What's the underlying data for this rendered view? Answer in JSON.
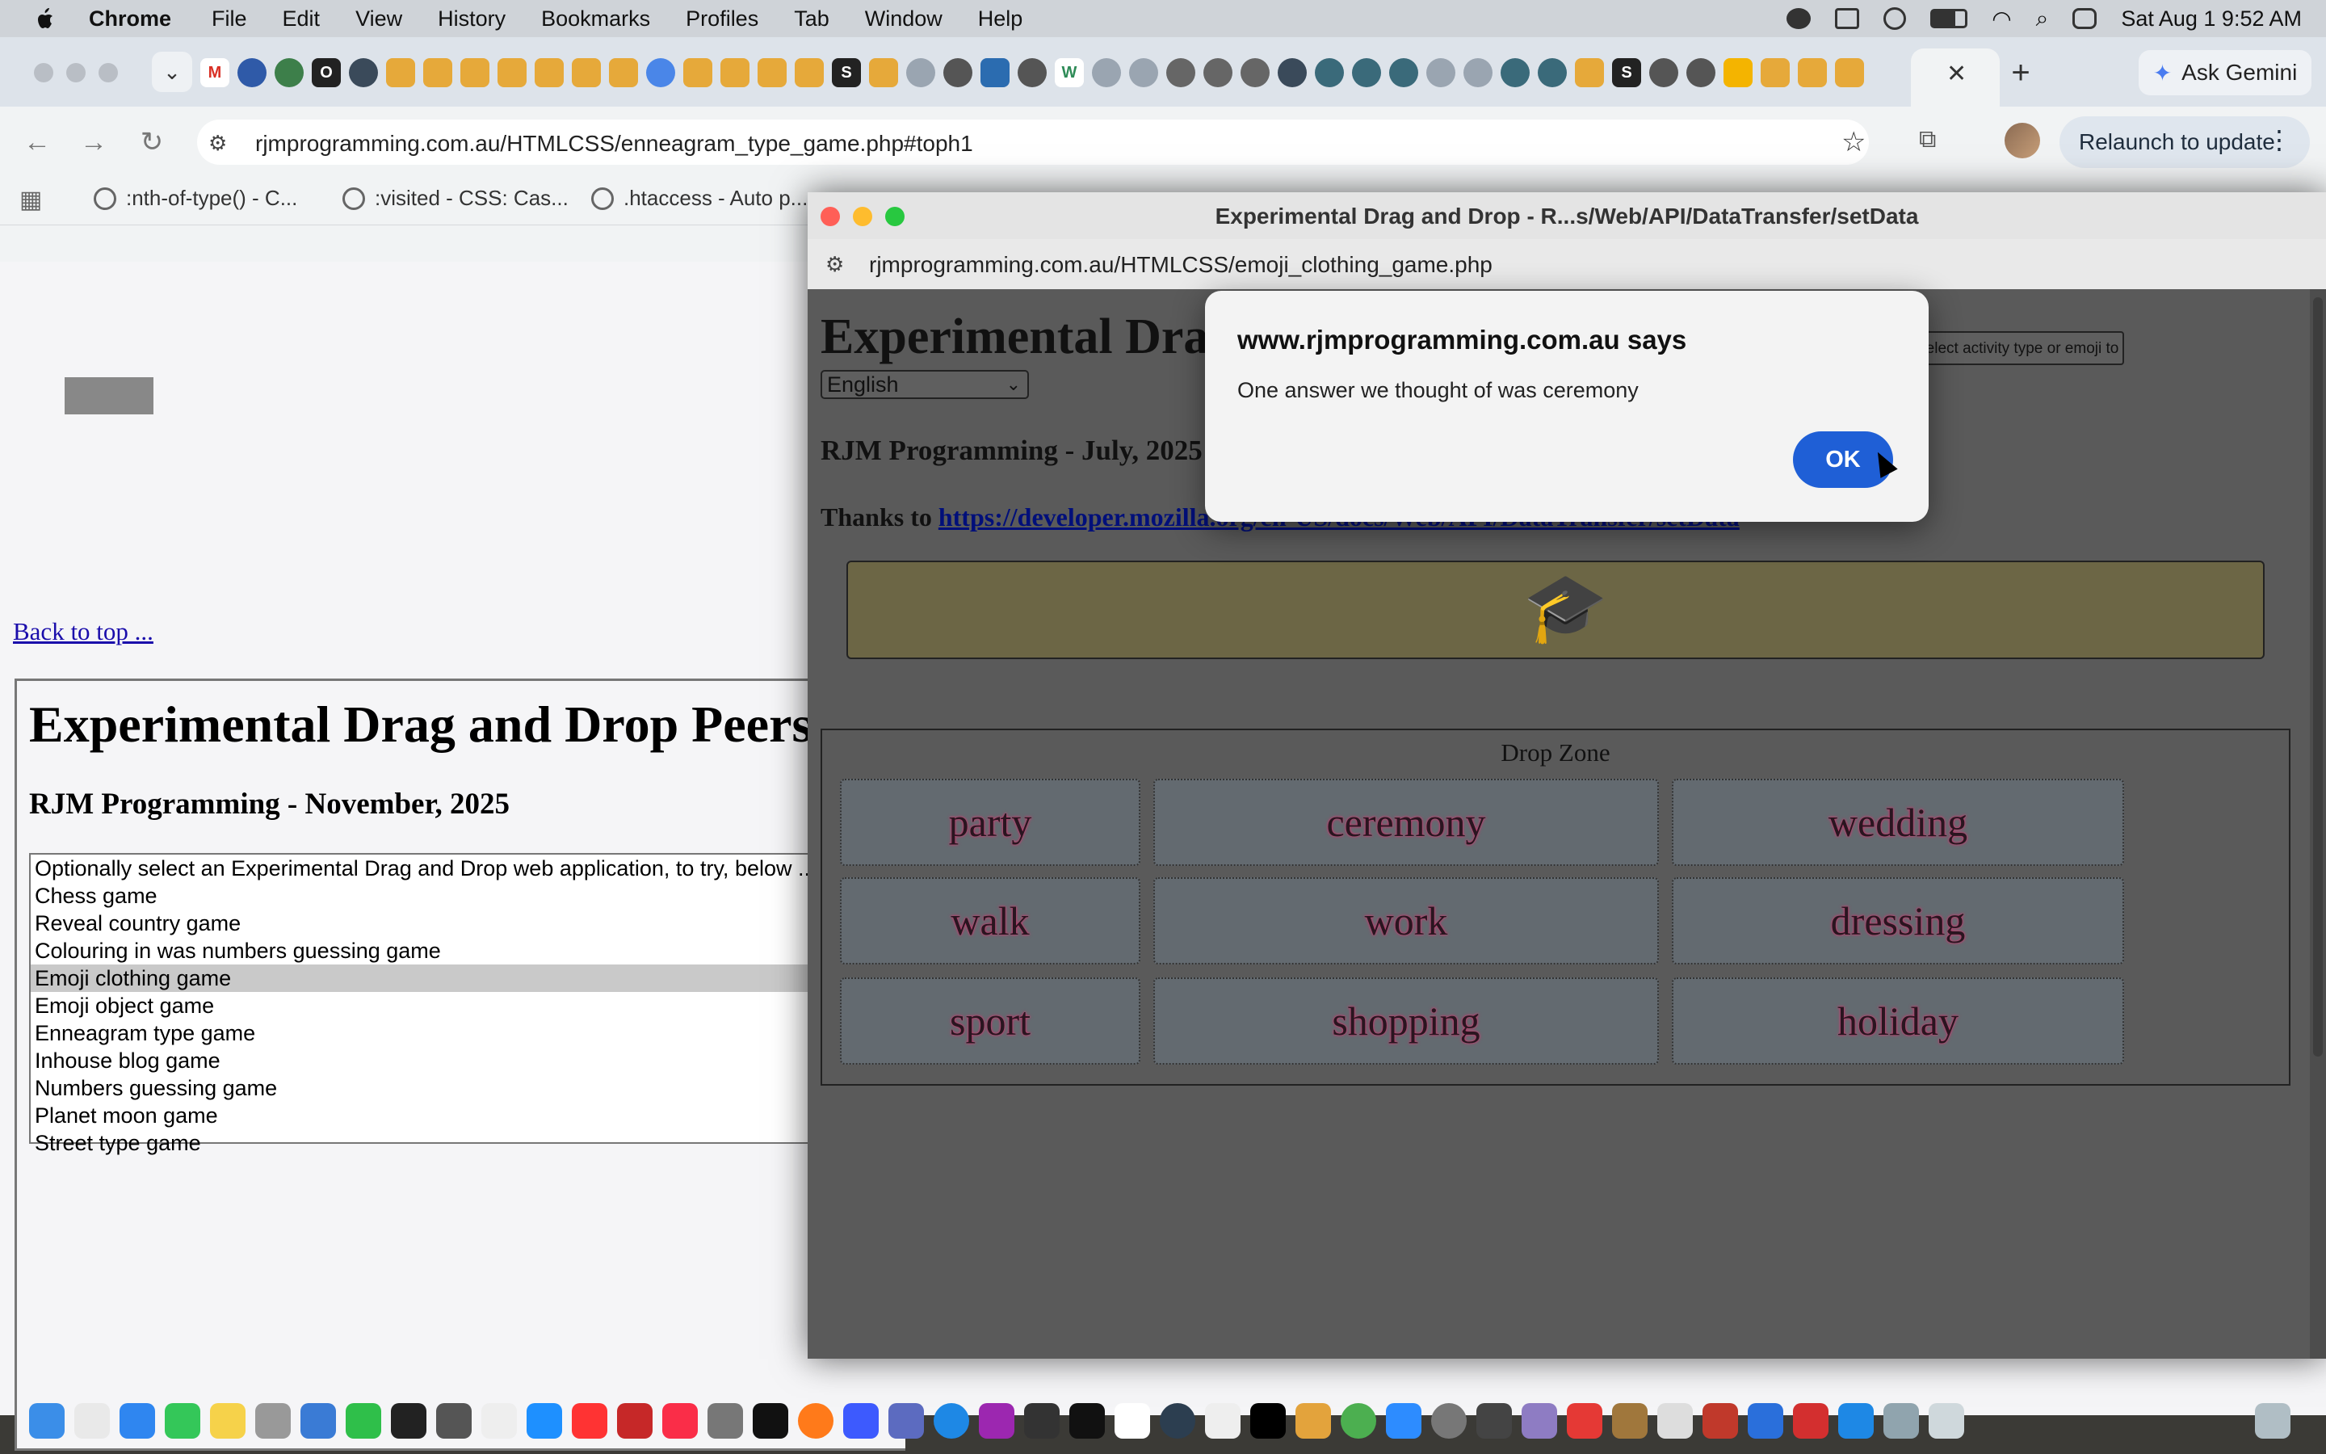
{
  "menubar": {
    "app": "Chrome",
    "items": [
      "File",
      "Edit",
      "View",
      "History",
      "Bookmarks",
      "Profiles",
      "Tab",
      "Window",
      "Help"
    ],
    "datetime": "Sat Aug 1  9:52 AM"
  },
  "browser": {
    "ask_gemini": "Ask Gemini",
    "url": "rjmprogramming.com.au/HTMLCSS/enneagram_type_game.php#toph1",
    "relaunch": "Relaunch to update",
    "bookmarks": [
      ":nth-of-type() - C...",
      ":visited - CSS: Cas...",
      ".htaccess - Auto p..."
    ]
  },
  "page": {
    "back_link": "Back to top ...",
    "title": "Experimental Drag and Drop Peers",
    "subtitle": "RJM Programming - November, 2025",
    "game_list": [
      "Optionally select an Experimental Drag and Drop web application, to try, below ...",
      "Chess game",
      "Reveal country game",
      "Colouring in was numbers guessing game",
      "Emoji clothing game",
      "Emoji object game",
      "Enneagram type game",
      "Inhouse blog game",
      "Numbers guessing game",
      "Planet moon game",
      "Street type game"
    ],
    "selected_index": 4
  },
  "popup": {
    "title": "Experimental Drag and Drop - R...s/Web/API/DataTransfer/setData",
    "url": "rjmprogramming.com.au/HTMLCSS/emoji_clothing_game.php",
    "heading": "Experimental Drag and Drop",
    "language": "English",
    "score_button": "Select activity type or emoji to score",
    "author": "RJM Programming - July, 2025",
    "thanks_prefix": "Thanks to",
    "thanks_link": "https://developer.mozilla.org/en-US/docs/Web/API/DataTransfer/setData",
    "drag_emoji": "🎓",
    "drop_zone_title": "Drop Zone",
    "drop_zone": [
      "party",
      "ceremony",
      "wedding",
      "walk",
      "work",
      "dressing",
      "sport",
      "shopping",
      "holiday"
    ]
  },
  "alert": {
    "title": "www.rjmprogramming.com.au says",
    "message": "One answer we thought of was ceremony",
    "ok": "OK"
  },
  "colors": {
    "menubar_bg": "#cfd3d8",
    "alert_ok": "#1f5fd6",
    "drop_text_glow": "#c0396b",
    "link": "#1a0dab"
  }
}
